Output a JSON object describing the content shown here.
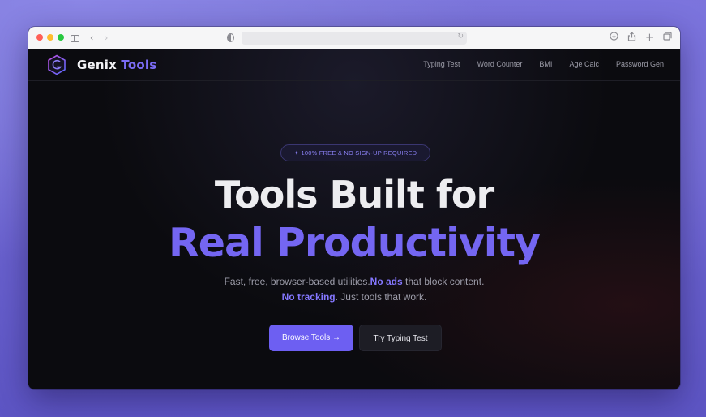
{
  "colors": {
    "accent": "#6d5ff2",
    "accent_text": "#7466f2",
    "background": "#0b0b0f"
  },
  "browser": {
    "icons": [
      "sidebar-icon",
      "back-arrow-icon",
      "forward-arrow-icon",
      "shield-icon",
      "reload-icon",
      "download-icon",
      "share-icon",
      "new-tab-icon",
      "tabs-overview-icon"
    ],
    "url": ""
  },
  "header": {
    "brand_word1": "Genix",
    "brand_word2": "Tools",
    "nav": [
      "Typing Test",
      "Word Counter",
      "BMI",
      "Age Calc",
      "Password Gen"
    ]
  },
  "hero": {
    "badge": "✦ 100% FREE & NO SIGN-UP REQUIRED",
    "title_line1": "Tools Built for",
    "title_line2": "Real Productivity",
    "sub1_text": "Fast, free, browser-based utilities.",
    "sub1_bold": "No ads",
    "sub1_tail": " that block content.",
    "sub2_bold": "No tracking",
    "sub2_tail": ". Just tools that work.",
    "primary_button": "Browse Tools →",
    "secondary_button": "Try Typing Test"
  }
}
